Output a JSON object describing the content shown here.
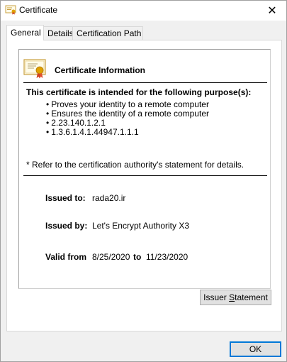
{
  "window": {
    "title": "Certificate",
    "close_glyph": "✕"
  },
  "tabs": [
    {
      "label": "General",
      "active": true
    },
    {
      "label": "Details",
      "active": false
    },
    {
      "label": "Certification Path",
      "active": false
    }
  ],
  "general": {
    "heading": "Certificate Information",
    "purpose_heading": "This certificate is intended for the following purpose(s):",
    "purposes": [
      "Proves your identity to a remote computer",
      "Ensures the identity of a remote computer",
      "2.23.140.1.2.1",
      "1.3.6.1.4.1.44947.1.1.1"
    ],
    "note": "* Refer to the certification authority's statement for details.",
    "issued_to_label": "Issued to:",
    "issued_to_value": "rada20.ir",
    "issued_by_label": "Issued by:",
    "issued_by_value": "Let's Encrypt Authority X3",
    "valid_from_label": "Valid from",
    "valid_from_value": "8/25/2020",
    "valid_to_label": "to",
    "valid_to_value": "11/23/2020"
  },
  "buttons": {
    "issuer_statement_pre": "Issuer ",
    "issuer_statement_mnemonic": "S",
    "issuer_statement_post": "tatement",
    "ok": "OK"
  },
  "icons": {
    "title": "certificate-icon",
    "header": "certificate-icon",
    "close": "close-icon"
  },
  "colors": {
    "focus_border": "#0078d7",
    "icon_accent": "#e0a000"
  }
}
